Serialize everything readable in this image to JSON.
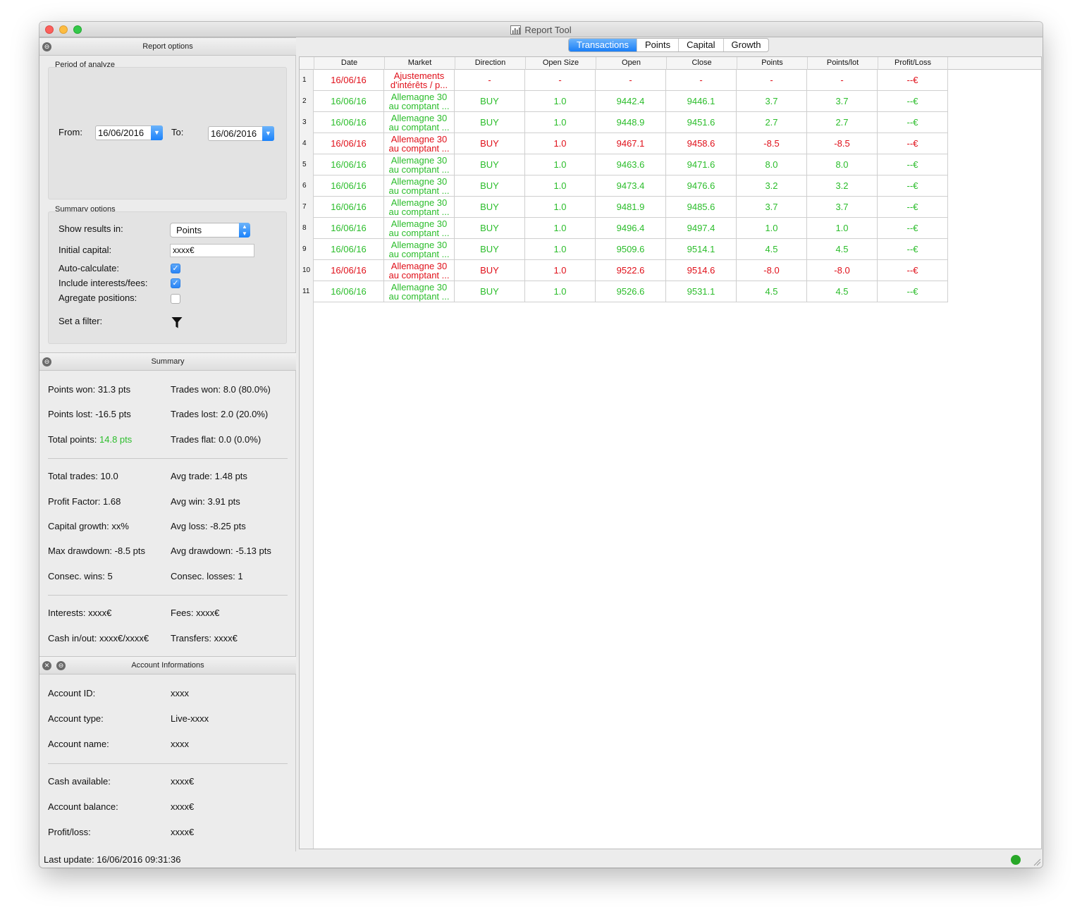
{
  "window": {
    "title": "Report Tool"
  },
  "report_options": {
    "header": "Report options",
    "period_group": "Period of analyze",
    "from_label": "From:",
    "from_value": "16/06/2016",
    "to_label": "To:",
    "to_value": "16/06/2016",
    "summary_group": "Summary options",
    "show_results_label": "Show results in:",
    "show_results_value": "Points",
    "initial_capital_label": "Initial capital:",
    "initial_capital_value": "xxxx€",
    "auto_calculate_label": "Auto-calculate:",
    "auto_calculate": true,
    "include_interests_label": "Include interests/fees:",
    "include_interests": true,
    "aggregate_label": "Agregate positions:",
    "aggregate": false,
    "filter_label": "Set a filter:",
    "filter_icon": "funnel-icon"
  },
  "summary": {
    "header": "Summary",
    "points_won_label": "Points won:",
    "points_won": "31.3 pts",
    "trades_won_label": "Trades won:",
    "trades_won": "8.0 (80.0%)",
    "points_lost_label": "Points lost:",
    "points_lost": "-16.5 pts",
    "trades_lost_label": "Trades lost:",
    "trades_lost": "2.0 (20.0%)",
    "total_points_label": "Total points:",
    "total_points": "14.8 pts",
    "trades_flat_label": "Trades flat:",
    "trades_flat": "0.0 (0.0%)",
    "total_trades_label": "Total trades:",
    "total_trades": "10.0",
    "avg_trade_label": "Avg trade:",
    "avg_trade": "1.48 pts",
    "profit_factor_label": "Profit Factor:",
    "profit_factor": "1.68",
    "avg_win_label": "Avg win:",
    "avg_win": "3.91 pts",
    "capital_growth_label": "Capital growth:",
    "capital_growth": "xx%",
    "avg_loss_label": "Avg loss:",
    "avg_loss": "-8.25 pts",
    "max_drawdown_label": "Max drawdown:",
    "max_drawdown": "-8.5 pts",
    "avg_drawdown_label": "Avg drawdown:",
    "avg_drawdown": "-5.13 pts",
    "consec_wins_label": "Consec. wins:",
    "consec_wins": "5",
    "consec_losses_label": "Consec. losses:",
    "consec_losses": "1",
    "interests_label": "Interests:",
    "interests": "xxxx€",
    "fees_label": "Fees:",
    "fees": "xxxx€",
    "cash_inout_label": "Cash in/out:",
    "cash_inout": "xxxx€/xxxx€",
    "transfers_label": "Transfers:",
    "transfers": "xxxx€"
  },
  "account": {
    "header": "Account Informations",
    "id_label": "Account ID:",
    "id": "xxxx",
    "type_label": "Account type:",
    "type": "Live-xxxx",
    "name_label": "Account name:",
    "name": "xxxx",
    "cash_label": "Cash available:",
    "cash": "xxxx€",
    "balance_label": "Account balance:",
    "balance": "xxxx€",
    "pl_label": "Profit/loss:",
    "pl": "xxxx€"
  },
  "tabs": [
    "Transactions",
    "Points",
    "Capital",
    "Growth"
  ],
  "active_tab": "Transactions",
  "table": {
    "columns": [
      "Date",
      "Market",
      "Direction",
      "Open Size",
      "Open",
      "Close",
      "Points",
      "Points/lot",
      "Profit/Loss"
    ],
    "rows": [
      {
        "n": "1",
        "color": "red",
        "date": "16/06/16",
        "m1": "Ajustements",
        "m2": "d'intérêts / p...",
        "dir": "-",
        "size": "-",
        "open": "-",
        "close": "-",
        "pts": "-",
        "ptslot": "-",
        "pl": "--€"
      },
      {
        "n": "2",
        "color": "green",
        "date": "16/06/16",
        "m1": "Allemagne 30",
        "m2": "au comptant ...",
        "dir": "BUY",
        "size": "1.0",
        "open": "9442.4",
        "close": "9446.1",
        "pts": "3.7",
        "ptslot": "3.7",
        "pl": "--€"
      },
      {
        "n": "3",
        "color": "green",
        "date": "16/06/16",
        "m1": "Allemagne 30",
        "m2": "au comptant ...",
        "dir": "BUY",
        "size": "1.0",
        "open": "9448.9",
        "close": "9451.6",
        "pts": "2.7",
        "ptslot": "2.7",
        "pl": "--€"
      },
      {
        "n": "4",
        "color": "red",
        "date": "16/06/16",
        "m1": "Allemagne 30",
        "m2": "au comptant ...",
        "dir": "BUY",
        "size": "1.0",
        "open": "9467.1",
        "close": "9458.6",
        "pts": "-8.5",
        "ptslot": "-8.5",
        "pl": "--€"
      },
      {
        "n": "5",
        "color": "green",
        "date": "16/06/16",
        "m1": "Allemagne 30",
        "m2": "au comptant ...",
        "dir": "BUY",
        "size": "1.0",
        "open": "9463.6",
        "close": "9471.6",
        "pts": "8.0",
        "ptslot": "8.0",
        "pl": "--€"
      },
      {
        "n": "6",
        "color": "green",
        "date": "16/06/16",
        "m1": "Allemagne 30",
        "m2": "au comptant ...",
        "dir": "BUY",
        "size": "1.0",
        "open": "9473.4",
        "close": "9476.6",
        "pts": "3.2",
        "ptslot": "3.2",
        "pl": "--€"
      },
      {
        "n": "7",
        "color": "green",
        "date": "16/06/16",
        "m1": "Allemagne 30",
        "m2": "au comptant ...",
        "dir": "BUY",
        "size": "1.0",
        "open": "9481.9",
        "close": "9485.6",
        "pts": "3.7",
        "ptslot": "3.7",
        "pl": "--€"
      },
      {
        "n": "8",
        "color": "green",
        "date": "16/06/16",
        "m1": "Allemagne 30",
        "m2": "au comptant ...",
        "dir": "BUY",
        "size": "1.0",
        "open": "9496.4",
        "close": "9497.4",
        "pts": "1.0",
        "ptslot": "1.0",
        "pl": "--€"
      },
      {
        "n": "9",
        "color": "green",
        "date": "16/06/16",
        "m1": "Allemagne 30",
        "m2": "au comptant ...",
        "dir": "BUY",
        "size": "1.0",
        "open": "9509.6",
        "close": "9514.1",
        "pts": "4.5",
        "ptslot": "4.5",
        "pl": "--€"
      },
      {
        "n": "10",
        "color": "red",
        "date": "16/06/16",
        "m1": "Allemagne 30",
        "m2": "au comptant ...",
        "dir": "BUY",
        "size": "1.0",
        "open": "9522.6",
        "close": "9514.6",
        "pts": "-8.0",
        "ptslot": "-8.0",
        "pl": "--€"
      },
      {
        "n": "11",
        "color": "green",
        "date": "16/06/16",
        "m1": "Allemagne 30",
        "m2": "au comptant ...",
        "dir": "BUY",
        "size": "1.0",
        "open": "9526.6",
        "close": "9531.1",
        "pts": "4.5",
        "ptslot": "4.5",
        "pl": "--€"
      }
    ]
  },
  "status": {
    "last_update": "Last update: 16/06/2016 09:31:36",
    "connection_icon": "connection-status-icon"
  },
  "colors": {
    "positive": "#2bbd2b",
    "negative": "#e0101a",
    "accent": "#1a82fb"
  }
}
